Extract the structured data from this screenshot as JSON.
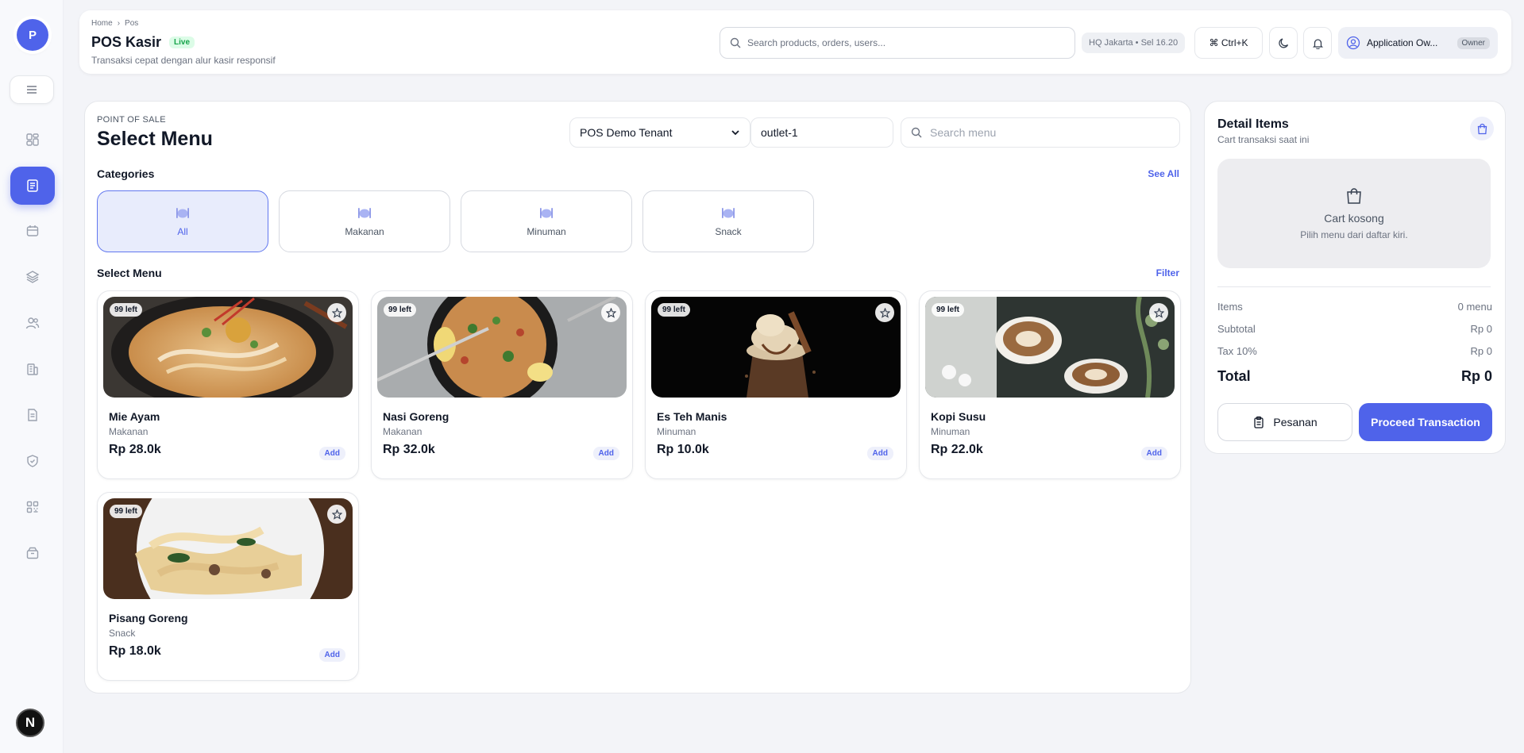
{
  "sidebar": {
    "logo_letter": "P",
    "user_initial": "N",
    "icons": [
      "dashboard-icon",
      "pos-icon",
      "calendar-icon",
      "layers-icon",
      "users-icon",
      "building-icon",
      "document-icon",
      "shield-icon",
      "qr-code-icon",
      "box-icon"
    ]
  },
  "header": {
    "breadcrumb": {
      "home": "Home",
      "separator": "›",
      "current": "Pos"
    },
    "title": "POS Kasir",
    "live_badge": "Live",
    "subtitle": "Transaksi cepat dengan alur kasir responsif",
    "search_placeholder": "Search products, orders, users...",
    "location_chip": "HQ Jakarta • Sel 16.20",
    "shortcut_label": "⌘ Ctrl+K",
    "profile_name": "Application Ow...",
    "profile_role": "Owner"
  },
  "main": {
    "kicker": "POINT OF SALE",
    "title": "Select Menu",
    "tenant_select": "POS Demo Tenant",
    "outlet_value": "outlet-1",
    "search_placeholder": "Search menu",
    "categories_label": "Categories",
    "see_all": "See All",
    "categories": [
      "All",
      "Makanan",
      "Minuman",
      "Snack"
    ],
    "menu_label": "Select Menu",
    "filter": "Filter",
    "products": [
      {
        "name": "Mie Ayam",
        "category": "Makanan",
        "price": "Rp 28.0k",
        "stock": "99 left",
        "add": "Add"
      },
      {
        "name": "Nasi Goreng",
        "category": "Makanan",
        "price": "Rp 32.0k",
        "stock": "99 left",
        "add": "Add"
      },
      {
        "name": "Es Teh Manis",
        "category": "Minuman",
        "price": "Rp 10.0k",
        "stock": "99 left",
        "add": "Add"
      },
      {
        "name": "Kopi Susu",
        "category": "Minuman",
        "price": "Rp 22.0k",
        "stock": "99 left",
        "add": "Add"
      },
      {
        "name": "Pisang Goreng",
        "category": "Snack",
        "price": "Rp 18.0k",
        "stock": "99 left",
        "add": "Add"
      }
    ]
  },
  "cart": {
    "title": "Detail Items",
    "subtitle": "Cart transaksi saat ini",
    "empty_title": "Cart kosong",
    "empty_sub": "Pilih menu dari daftar kiri.",
    "items_label": "Items",
    "items_value": "0 menu",
    "subtotal_label": "Subtotal",
    "subtotal_value": "Rp 0",
    "tax_label": "Tax 10%",
    "tax_value": "Rp 0",
    "total_label": "Total",
    "total_value": "Rp 0",
    "pesanan_label": "Pesanan",
    "proceed_label": "Proceed Transaction"
  },
  "colors": {
    "accent": "#4f63ea",
    "live": "#16a34a"
  }
}
